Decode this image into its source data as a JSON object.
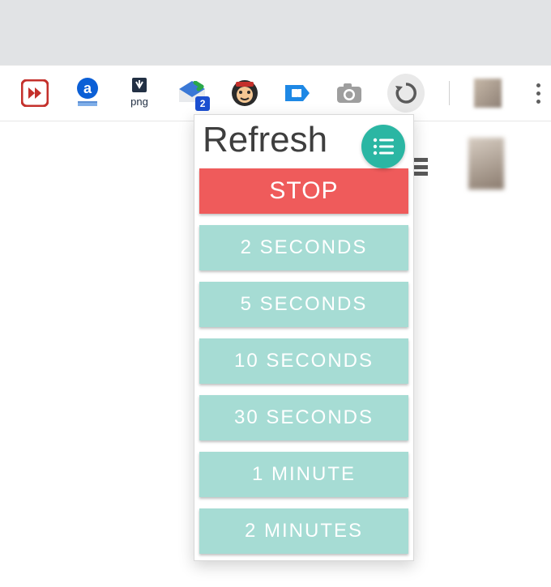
{
  "toolbar": {
    "icons": [
      {
        "name": "fast-forward-icon"
      },
      {
        "name": "amazon-assistant-icon"
      },
      {
        "name": "png-download-icon",
        "caption": "png"
      },
      {
        "name": "inbox-icon",
        "badge": "2"
      },
      {
        "name": "avatar-monkey-icon"
      },
      {
        "name": "tag-icon"
      },
      {
        "name": "camera-icon"
      },
      {
        "name": "history-refresh-icon"
      }
    ]
  },
  "popup": {
    "title": "Refresh",
    "fab_name": "list-icon",
    "stop_label": "STOP",
    "options": [
      "2 SECONDS",
      "5 SECONDS",
      "10 SECONDS",
      "30 SECONDS",
      "1 MINUTE",
      "2 MINUTES"
    ]
  }
}
